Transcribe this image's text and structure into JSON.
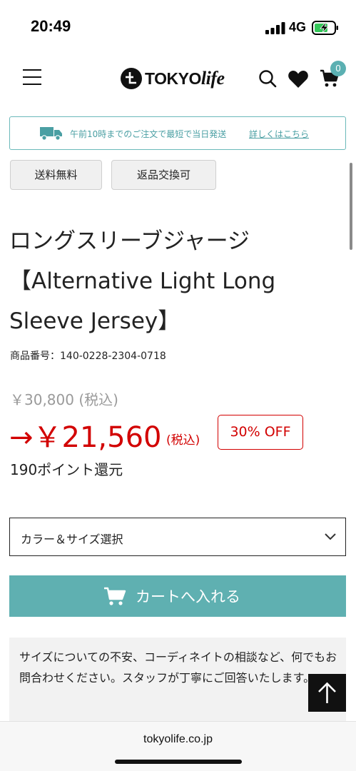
{
  "status_bar": {
    "time": "20:49",
    "network": "4G",
    "icons": [
      "signal-icon",
      "battery-charging-icon"
    ]
  },
  "header": {
    "logo_text_bold": "TOKYO",
    "logo_text_script": "life",
    "cart_count": "0",
    "icons": [
      "menu-icon",
      "logo-mark-icon",
      "search-icon",
      "heart-icon",
      "cart-icon"
    ],
    "accent_color": "#5bb0b2"
  },
  "shipping_banner": {
    "text": "午前10時までのご注文で最短で当日発送",
    "link": "詳しくはこちら",
    "icon": "truck-icon"
  },
  "tags": [
    "送料無料",
    "返品交換可"
  ],
  "product": {
    "title_line1": "ロングスリーブジャージ",
    "title_line2": "【Alternative Light Long",
    "title_line3": "Sleeve Jersey】",
    "code": "商品番号：140-0228-2304-0718",
    "original_price": "￥30,800 (税込)",
    "sale_price": "→￥21,560",
    "sale_tax_note": "(税込)",
    "discount": "30% OFF",
    "points": "190ポイント還元",
    "sale_color": "#d20000"
  },
  "size_select": {
    "label": "カラー＆サイズ選択",
    "icon": "chevron-down-icon"
  },
  "add_to_cart": {
    "label": "カートへ入れる",
    "icon": "cart-icon",
    "color": "#5fb0b1"
  },
  "support": {
    "text": "サイズについての不安、コーディネイトの相談など、何でもお問合わせください。スタッフが丁寧にご回答いたします。"
  },
  "back_to_top": {
    "icon": "arrow-up-icon"
  },
  "browser": {
    "url": "tokyolife.co.jp"
  }
}
